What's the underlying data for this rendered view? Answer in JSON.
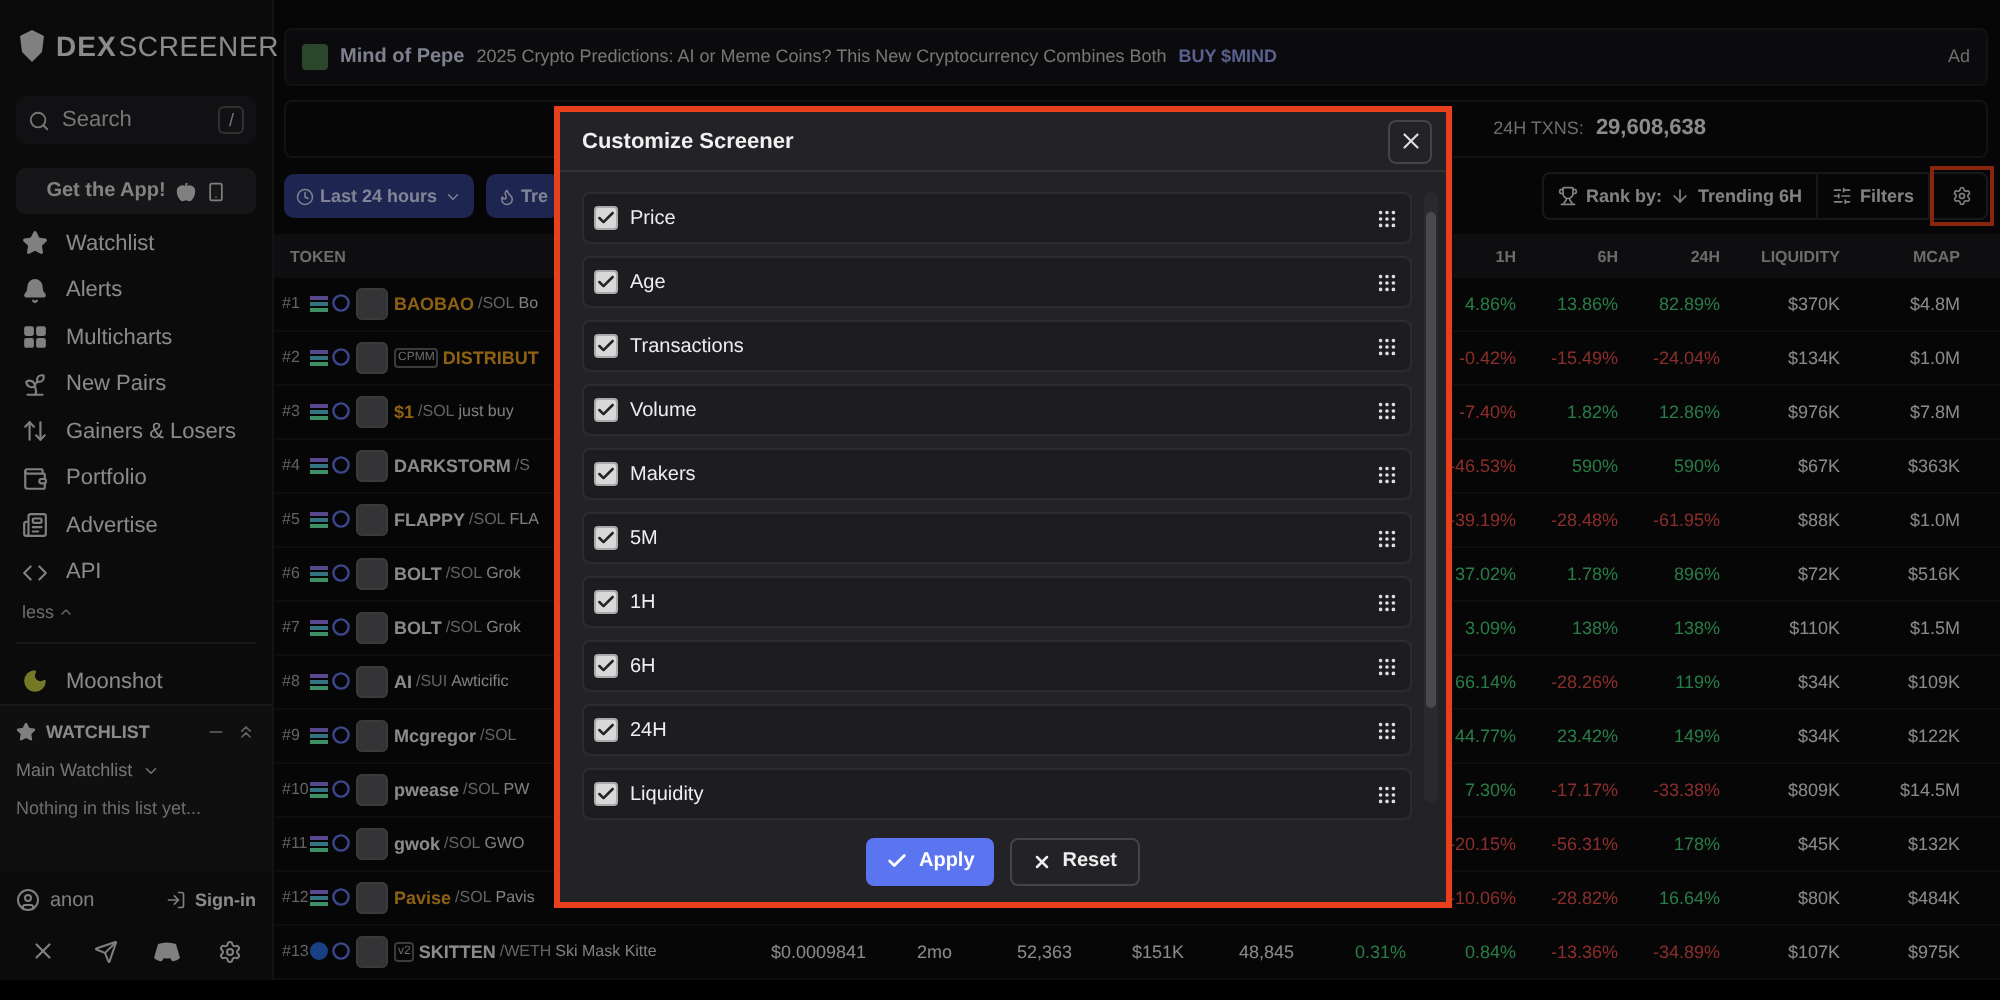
{
  "sidebar": {
    "logo": {
      "bold": "DEX",
      "light": "SCREENER"
    },
    "search": {
      "placeholder": "Search",
      "shortcut": "/"
    },
    "get_app": "Get the App!",
    "nav": [
      {
        "kind": "star",
        "label": "Watchlist"
      },
      {
        "kind": "bell",
        "label": "Alerts"
      },
      {
        "kind": "grid",
        "label": "Multicharts"
      },
      {
        "kind": "sprout",
        "label": "New Pairs"
      },
      {
        "kind": "arrows",
        "label": "Gainers & Losers"
      },
      {
        "kind": "wallet",
        "label": "Portfolio"
      },
      {
        "kind": "ad",
        "label": "Advertise"
      },
      {
        "kind": "code",
        "label": "API"
      }
    ],
    "less": "less",
    "moonshot": "Moonshot",
    "watchlist": {
      "title": "WATCHLIST",
      "list": "Main Watchlist",
      "empty": "Nothing in this list yet..."
    },
    "user": "anon",
    "sign_in": "Sign-in"
  },
  "banner": {
    "brand": "Mind of Pepe",
    "text": "2025 Crypto Predictions: AI or Meme Coins? This New Cryptocurrency Combines Both",
    "cta": "BUY $MIND",
    "ad": "Ad"
  },
  "stats": {
    "label": "24H TXNS:",
    "value": "29,608,638"
  },
  "toolbar": {
    "period": "Last 24 hours",
    "trending": "Tre",
    "rank_label": "Rank by:",
    "rank_value": "Trending 6H",
    "filters": "Filters",
    "settings_highlighted": true
  },
  "table": {
    "token_header": "TOKEN",
    "right_headers": [
      "1H",
      "6H",
      "24H",
      "LIQUIDITY",
      "MCAP"
    ],
    "rows": [
      {
        "rank": "#1",
        "kind": "stripes",
        "name": "BAOBAO",
        "quote": "/SOL",
        "desc": "Bo",
        "highlighted": true,
        "changes": [
          {
            "text": "4.86%",
            "up": true
          },
          {
            "text": "13.86%",
            "up": true
          },
          {
            "text": "82.89%",
            "up": true
          }
        ],
        "liquidity": "$370K",
        "mcap": "$4.8M"
      },
      {
        "rank": "#2",
        "kind": "stripes",
        "badge": "CPMM",
        "name": "DISTRIBUT",
        "highlighted": true,
        "changes": [
          {
            "text": "-0.42%",
            "up": false
          },
          {
            "text": "-15.49%",
            "up": false
          },
          {
            "text": "-24.04%",
            "up": false
          }
        ],
        "liquidity": "$134K",
        "mcap": "$1.0M"
      },
      {
        "rank": "#3",
        "kind": "stripes",
        "name": "$1",
        "quote": "/SOL",
        "desc": "just buy",
        "highlighted": true,
        "changes": [
          {
            "text": "-7.40%",
            "up": false
          },
          {
            "text": "1.82%",
            "up": true
          },
          {
            "text": "12.86%",
            "up": true
          }
        ],
        "liquidity": "$976K",
        "mcap": "$7.8M"
      },
      {
        "rank": "#4",
        "kind": "stripes",
        "name": "DARKSTORM",
        "quote": "/S",
        "highlighted": false,
        "changes": [
          {
            "text": "-46.53%",
            "up": false
          },
          {
            "text": "590%",
            "up": true
          },
          {
            "text": "590%",
            "up": true
          }
        ],
        "liquidity": "$67K",
        "mcap": "$363K"
      },
      {
        "rank": "#5",
        "kind": "stripes",
        "name": "FLAPPY",
        "quote": "/SOL",
        "desc": "FLA",
        "highlighted": false,
        "changes": [
          {
            "text": "-39.19%",
            "up": false
          },
          {
            "text": "-28.48%",
            "up": false
          },
          {
            "text": "-61.95%",
            "up": false
          }
        ],
        "liquidity": "$88K",
        "mcap": "$1.0M"
      },
      {
        "rank": "#6",
        "kind": "stripes",
        "name": "BOLT",
        "quote": "/SOL",
        "desc": "Grok",
        "highlighted": false,
        "changes": [
          {
            "text": "37.02%",
            "up": true
          },
          {
            "text": "1.78%",
            "up": true
          },
          {
            "text": "896%",
            "up": true
          }
        ],
        "liquidity": "$72K",
        "mcap": "$516K"
      },
      {
        "rank": "#7",
        "kind": "stripes",
        "name": "BOLT",
        "quote": "/SOL",
        "desc": "Grok",
        "highlighted": false,
        "changes": [
          {
            "text": "3.09%",
            "up": true
          },
          {
            "text": "138%",
            "up": true
          },
          {
            "text": "138%",
            "up": true
          }
        ],
        "liquidity": "$110K",
        "mcap": "$1.5M"
      },
      {
        "rank": "#8",
        "kind": "stripes",
        "name": "AI",
        "quote": "/SUI",
        "desc": "Awticific",
        "highlighted": false,
        "changes": [
          {
            "text": "66.14%",
            "up": true
          },
          {
            "text": "-28.26%",
            "up": false
          },
          {
            "text": "119%",
            "up": true
          }
        ],
        "liquidity": "$34K",
        "mcap": "$109K"
      },
      {
        "rank": "#9",
        "kind": "stripes",
        "name": "Mcgregor",
        "quote": "/SOL",
        "highlighted": false,
        "changes": [
          {
            "text": "44.77%",
            "up": true
          },
          {
            "text": "23.42%",
            "up": true
          },
          {
            "text": "149%",
            "up": true
          }
        ],
        "liquidity": "$34K",
        "mcap": "$122K"
      },
      {
        "rank": "#10",
        "kind": "stripes",
        "name": "pwease",
        "quote": "/SOL",
        "desc": "PW",
        "highlighted": false,
        "changes": [
          {
            "text": "7.30%",
            "up": true
          },
          {
            "text": "-17.17%",
            "up": false
          },
          {
            "text": "-33.38%",
            "up": false
          }
        ],
        "liquidity": "$809K",
        "mcap": "$14.5M"
      },
      {
        "rank": "#11",
        "kind": "stripes",
        "name": "gwok",
        "quote": "/SOL",
        "desc": "GWO",
        "highlighted": false,
        "changes": [
          {
            "text": "-20.15%",
            "up": false
          },
          {
            "text": "-56.31%",
            "up": false
          },
          {
            "text": "178%",
            "up": true
          }
        ],
        "liquidity": "$45K",
        "mcap": "$132K"
      },
      {
        "rank": "#12",
        "kind": "stripes",
        "name": "Pavise",
        "quote": "/SOL",
        "desc": "Pavis",
        "highlighted": true,
        "changes": [
          {
            "text": "-10.06%",
            "up": false
          },
          {
            "text": "-28.82%",
            "up": false
          },
          {
            "text": "16.64%",
            "up": true
          }
        ],
        "liquidity": "$80K",
        "mcap": "$484K"
      },
      {
        "rank": "#13",
        "kind": "dot",
        "badge": "v2",
        "name": "SKITTEN",
        "quote": "/WETH",
        "desc": "Ski Mask Kitte",
        "highlighted": false,
        "mid": {
          "price": "$0.0009841",
          "age": "2mo",
          "txns": "52,363",
          "volume": "$151K",
          "makers": "48,845",
          "m5": {
            "text": "0.31%",
            "up": true
          }
        },
        "changes": [
          {
            "text": "0.84%",
            "up": true
          },
          {
            "text": "-13.36%",
            "up": false
          },
          {
            "text": "-34.89%",
            "up": false
          }
        ],
        "liquidity": "$107K",
        "mcap": "$975K"
      }
    ]
  },
  "dialog": {
    "title": "Customize Screener",
    "columns": [
      {
        "label": "Price",
        "checked": true
      },
      {
        "label": "Age",
        "checked": true
      },
      {
        "label": "Transactions",
        "checked": true
      },
      {
        "label": "Volume",
        "checked": true
      },
      {
        "label": "Makers",
        "checked": true
      },
      {
        "label": "5M",
        "checked": true
      },
      {
        "label": "1H",
        "checked": true
      },
      {
        "label": "6H",
        "checked": true
      },
      {
        "label": "24H",
        "checked": true
      },
      {
        "label": "Liquidity",
        "checked": true
      }
    ],
    "apply": "Apply",
    "reset": "Reset"
  }
}
